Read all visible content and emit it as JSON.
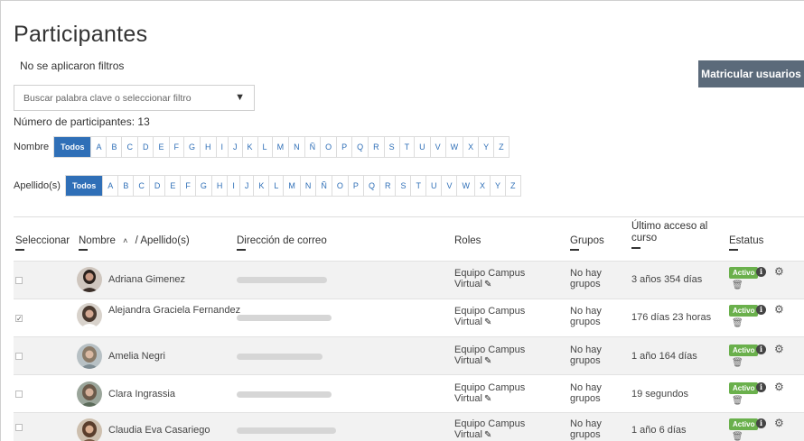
{
  "page": {
    "title": "Participantes",
    "filters_status": "No se aplicaron filtros",
    "enroll_button": "Matricular usuarios",
    "filter_placeholder": "Buscar palabra clave o seleccionar filtro",
    "participant_count": "Número de participantes: 13"
  },
  "initials": {
    "first_name_label": "Nombre",
    "last_name_label": "Apellido(s)",
    "all_label": "Todos",
    "letters": [
      "A",
      "B",
      "C",
      "D",
      "E",
      "F",
      "G",
      "H",
      "I",
      "J",
      "K",
      "L",
      "M",
      "N",
      "Ñ",
      "O",
      "P",
      "Q",
      "R",
      "S",
      "T",
      "U",
      "V",
      "W",
      "X",
      "Y",
      "Z"
    ]
  },
  "table": {
    "headers": {
      "select": "Seleccionar",
      "name": "Nombre",
      "sort_arrow": "˄",
      "surname": "/ Apellido(s)",
      "email": "Dirección de correo",
      "roles": "Roles",
      "groups": "Grupos",
      "last_access": "Último acceso al curso",
      "status": "Estatus"
    },
    "rows": [
      {
        "name": "Adriana Gimenez",
        "checked": false,
        "role_line1": "Equipo Campus",
        "role_line2": "Virtual",
        "groups_line1": "No hay",
        "groups_line2": "grupos",
        "last_access": "3 años 354 días",
        "status": "Activo"
      },
      {
        "name": "Alejandra Graciela Fernandez",
        "checked": true,
        "role_line1": "Equipo Campus",
        "role_line2": "Virtual",
        "groups_line1": "No hay",
        "groups_line2": "grupos",
        "last_access": "176 días 23 horas",
        "status": "Activo"
      },
      {
        "name": "Amelia Negri",
        "checked": false,
        "role_line1": "Equipo Campus",
        "role_line2": "Virtual",
        "groups_line1": "No hay",
        "groups_line2": "grupos",
        "last_access": "1 año 164 días",
        "status": "Activo"
      },
      {
        "name": "Clara Ingrassia",
        "checked": false,
        "role_line1": "Equipo Campus",
        "role_line2": "Virtual",
        "groups_line1": "No hay",
        "groups_line2": "grupos",
        "last_access": "19 segundos",
        "status": "Activo"
      },
      {
        "name": "Claudia Eva Casariego",
        "checked": false,
        "role_line1": "Equipo Campus",
        "role_line2": "Virtual",
        "groups_line1": "No hay",
        "groups_line2": "grupos",
        "last_access": "1 año 6 días",
        "status": "Activo"
      }
    ]
  },
  "icons": {
    "edit": "pencil-icon",
    "info": "info-icon",
    "settings": "gear-icon",
    "delete": "trash-icon",
    "dropdown": "caret-down-icon"
  },
  "colors": {
    "accent_blue": "#2f6fb7",
    "enroll_button_bg": "#5b6a7a",
    "active_badge": "#6ab04c"
  }
}
